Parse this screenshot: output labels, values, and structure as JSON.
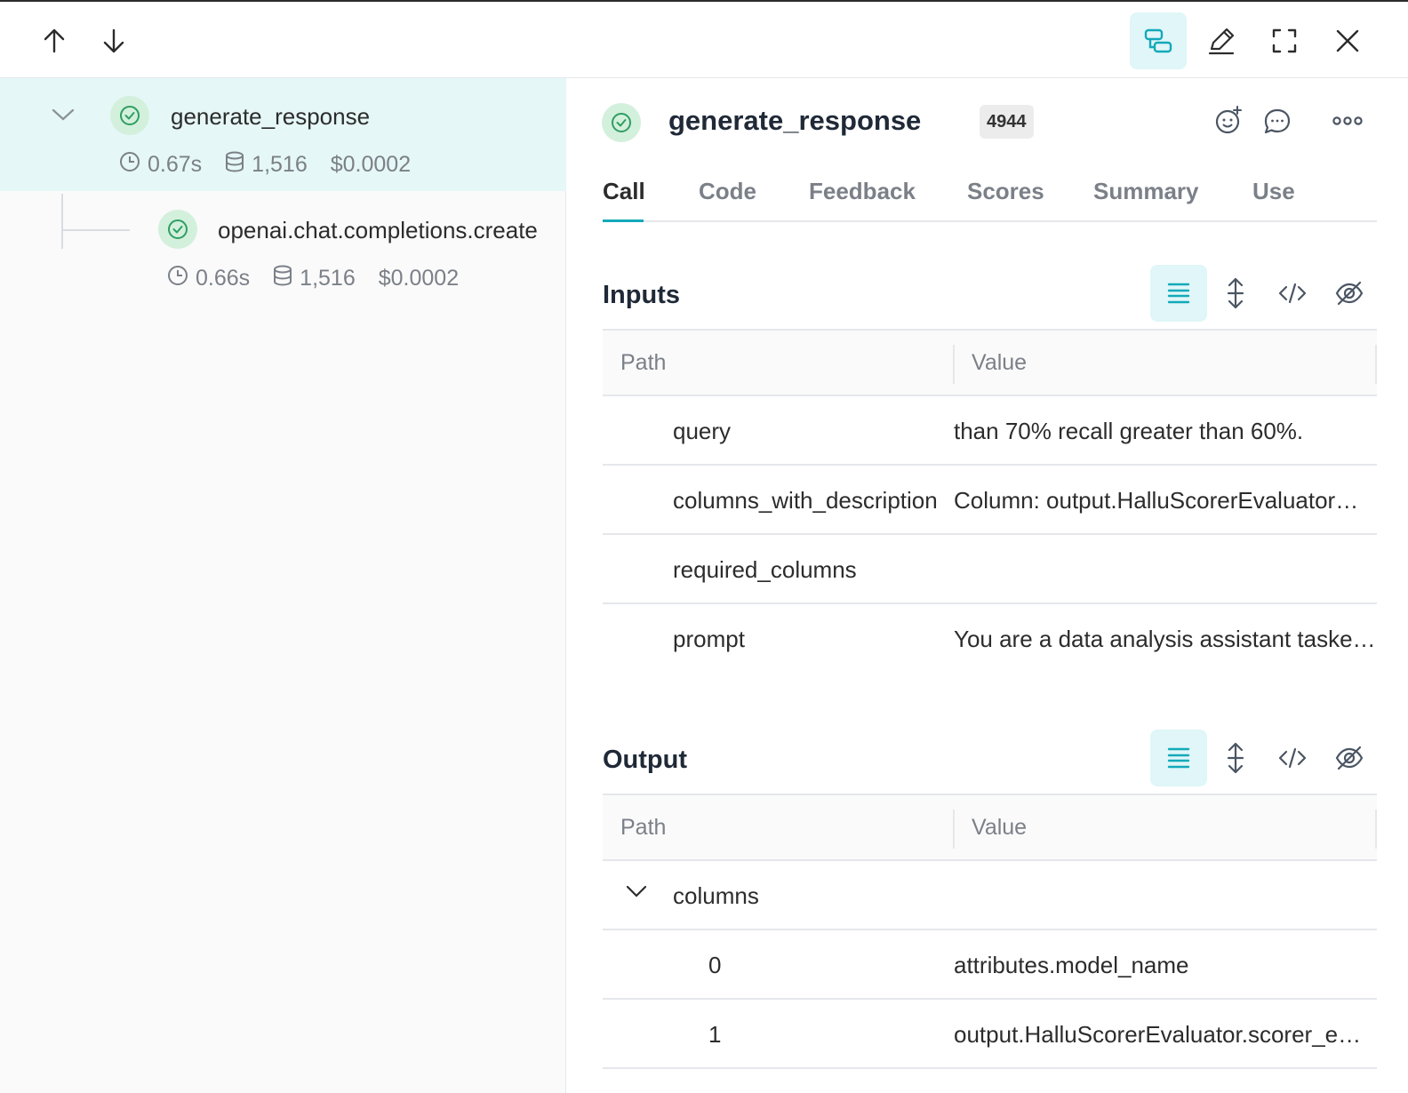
{
  "toolbar": {
    "up_icon": "arrow-up-icon",
    "down_icon": "arrow-down-icon",
    "right_icons": [
      "layers-icon",
      "pencil-icon",
      "fullscreen-icon",
      "close-icon"
    ]
  },
  "tree": {
    "nodes": [
      {
        "name": "generate_response",
        "duration": "0.67s",
        "tokens": "1,516",
        "cost": "$0.0002",
        "selected": true
      },
      {
        "name": "openai.chat.completions.create",
        "duration": "0.66s",
        "tokens": "1,516",
        "cost": "$0.0002",
        "selected": false
      }
    ]
  },
  "detail": {
    "title": "generate_response",
    "badge": "4944",
    "tabs": [
      "Call",
      "Code",
      "Feedback",
      "Scores",
      "Summary",
      "Use"
    ],
    "active_tab": "Call",
    "inputs": {
      "title": "Inputs",
      "header": {
        "path": "Path",
        "value": "Value"
      },
      "rows": [
        {
          "key": "query",
          "value": "than 70% recall greater than 60%."
        },
        {
          "key": "columns_with_description",
          "value": "Column: output.HalluScorerEvaluator…"
        },
        {
          "key": "required_columns",
          "value": ""
        },
        {
          "key": "prompt",
          "value": "You are a data analysis assistant taske…"
        }
      ]
    },
    "output": {
      "title": "Output",
      "header": {
        "path": "Path",
        "value": "Value"
      },
      "rows": [
        {
          "key": "columns",
          "value": ""
        },
        {
          "key": "0",
          "value": "attributes.model_name"
        },
        {
          "key": "1",
          "value": "output.HalluScorerEvaluator.scorer_e…"
        }
      ]
    }
  },
  "colors": {
    "accent": "#13a9ba",
    "selected_bg": "#e5f7f6",
    "success": "#2f9e63"
  }
}
